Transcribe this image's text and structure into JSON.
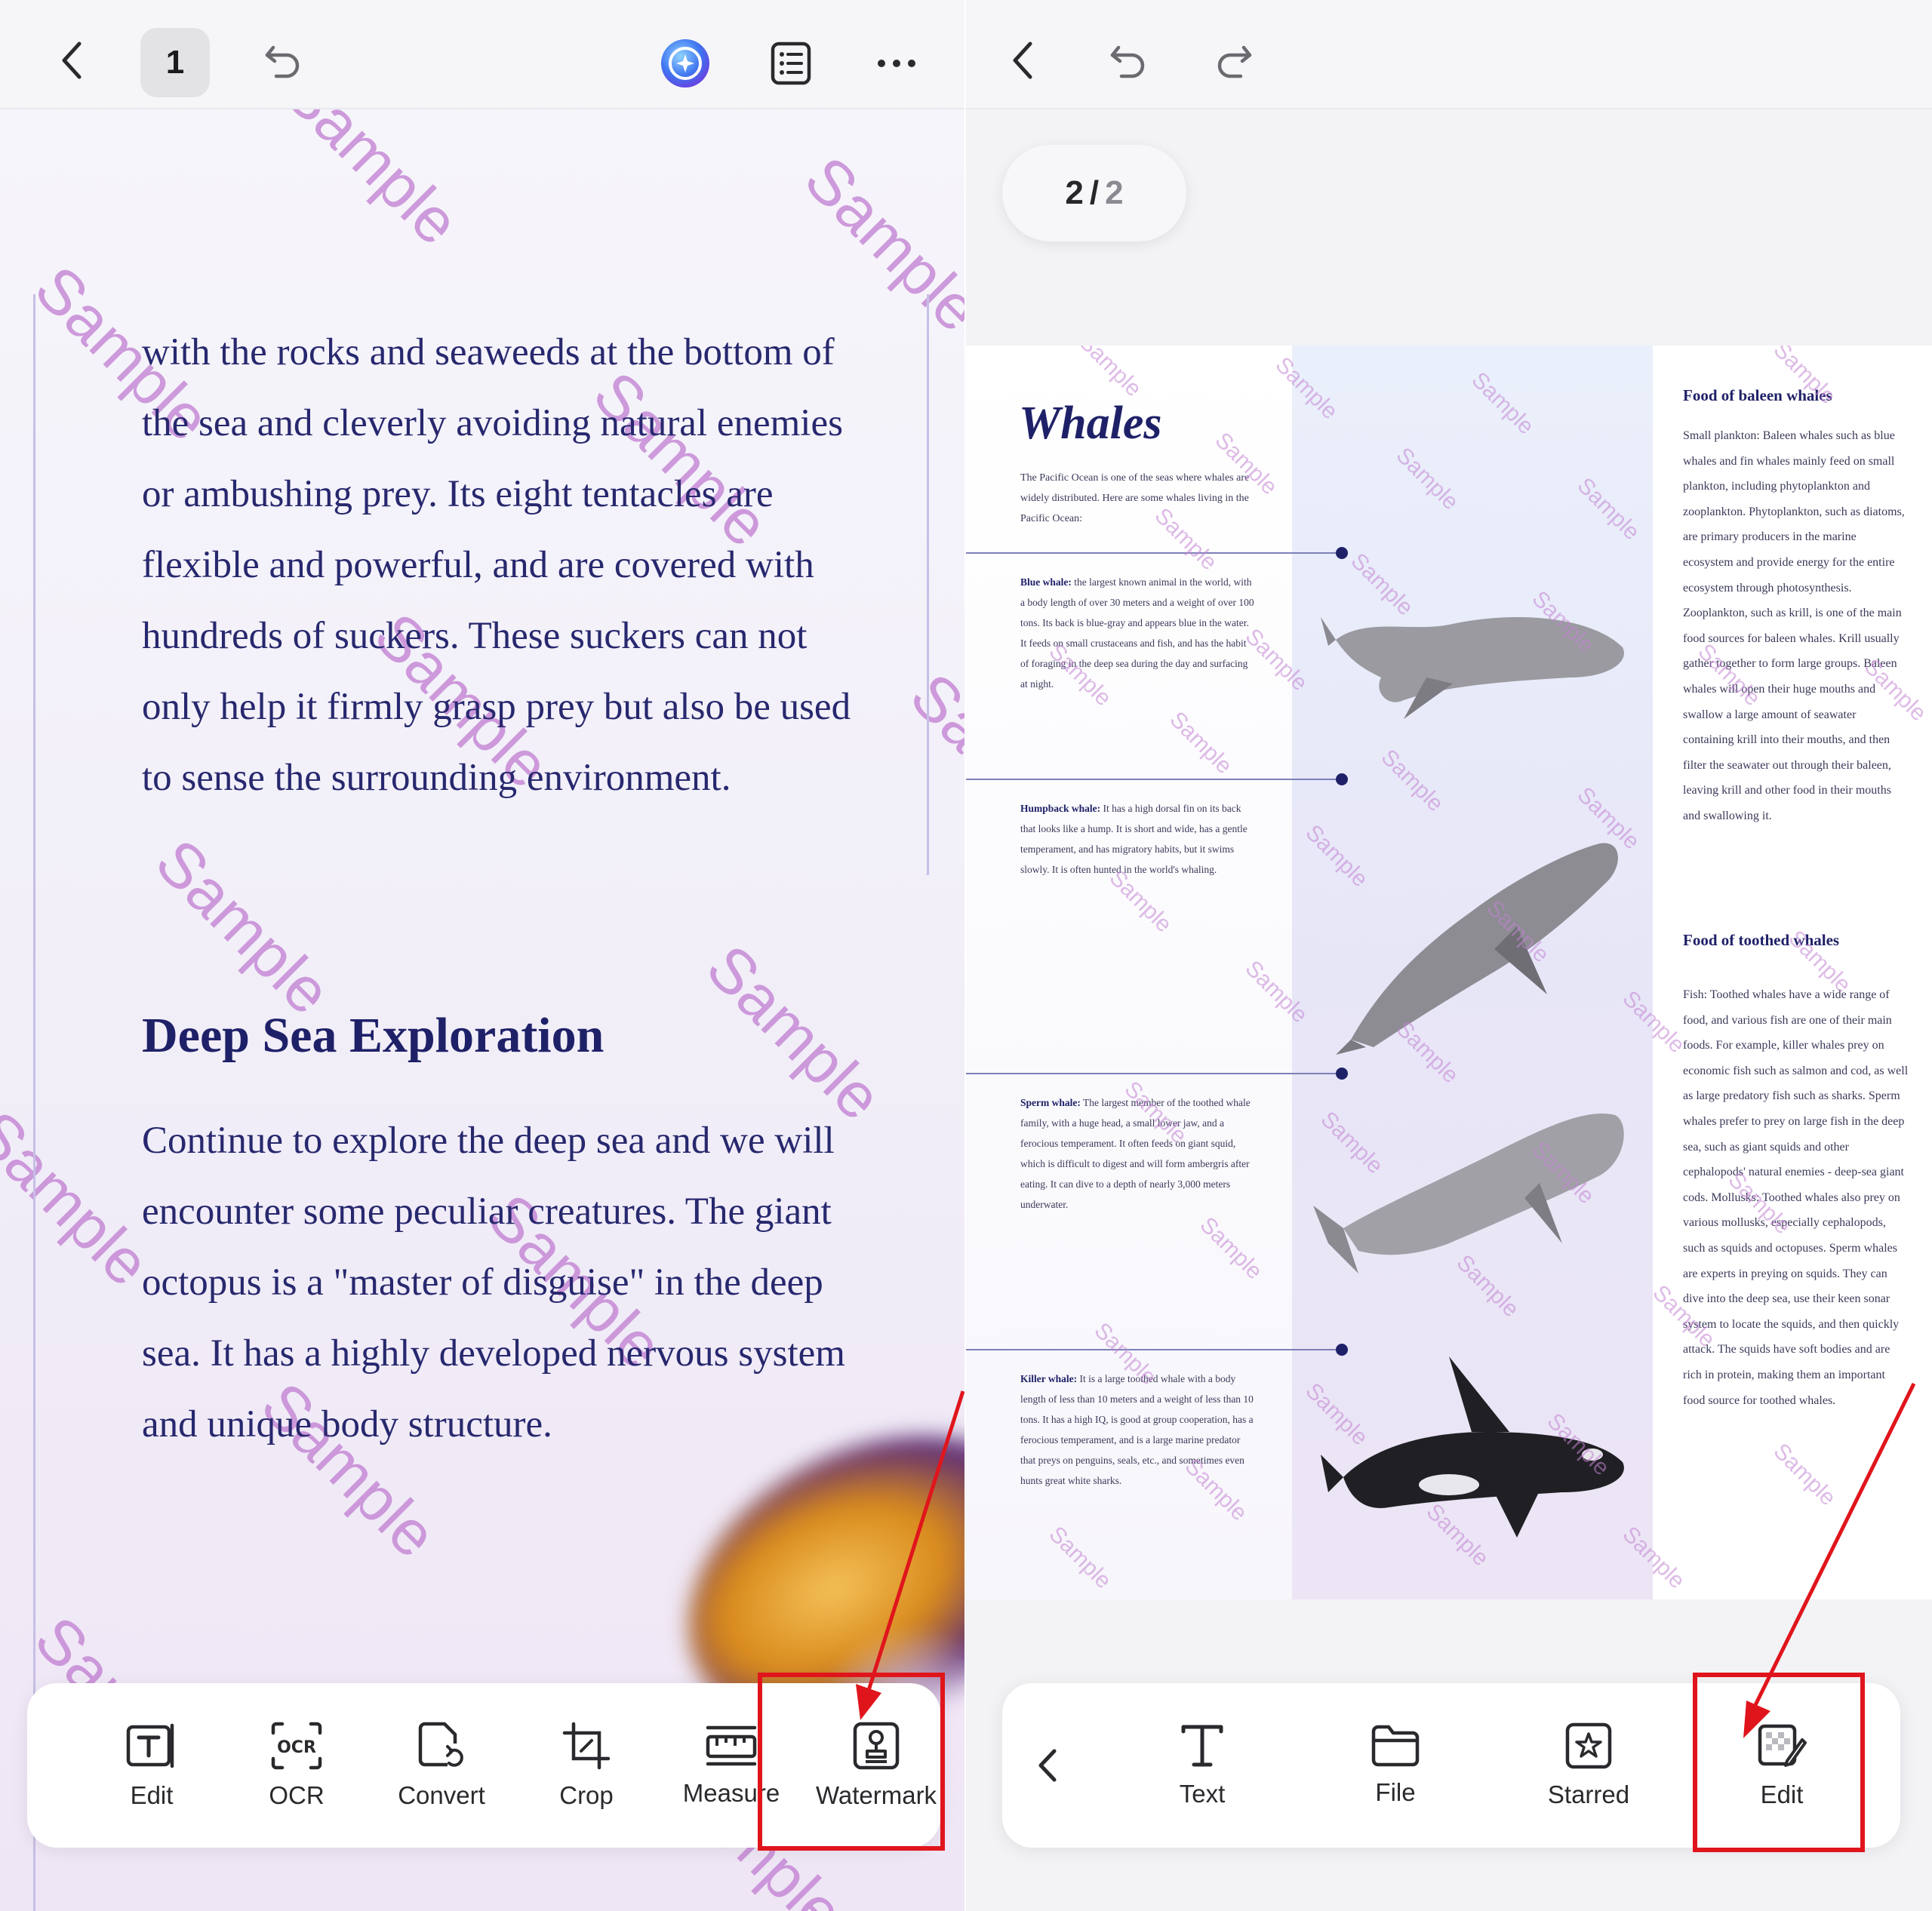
{
  "left": {
    "page_number": "1",
    "paragraph1": "with the rocks and seaweeds at the bottom of the sea and cleverly avoiding natural enemies or ambushing prey. Its eight tentacles are flexible and powerful, and are covered with hundreds of suckers. These suckers can not only help it firmly grasp prey but also be used to sense the surrounding environment.",
    "heading": "Deep Sea Exploration",
    "paragraph2": "Continue to explore the deep sea and we will encounter some peculiar creatures. The giant octopus is a \"master of disguise\" in the deep sea. It has a highly developed nervous system and unique body structure.",
    "watermark_text": "Sample",
    "toolbar": [
      {
        "label": "Edit",
        "icon": "edit-text-icon"
      },
      {
        "label": "OCR",
        "icon": "ocr-icon"
      },
      {
        "label": "Convert",
        "icon": "convert-icon"
      },
      {
        "label": "Crop",
        "icon": "crop-icon"
      },
      {
        "label": "Measure",
        "icon": "measure-icon"
      },
      {
        "label": "Watermark",
        "icon": "watermark-icon"
      }
    ]
  },
  "right": {
    "page_current": "2",
    "page_sep": "/",
    "page_total": "2",
    "doc": {
      "title": "Whales",
      "intro": "The Pacific Ocean is one of the seas where whales are widely distributed. Here are some whales living in the Pacific Ocean:",
      "whales": [
        {
          "name": "Blue whale:",
          "text": "the largest known animal in the world, with a body length of over 30 meters and a weight of over 100 tons. Its back is blue-gray and appears blue in the water. It feeds on small crustaceans and fish, and has the habit of foraging in the deep sea during the day and surfacing at night."
        },
        {
          "name": "Humpback whale:",
          "text": "It has a high dorsal fin on its back that looks like a hump. It is short and wide, has a gentle temperament, and has migratory habits, but it swims slowly. It is often hunted in the world's whaling."
        },
        {
          "name": "Sperm whale:",
          "text": "The largest member of the toothed whale family, with a huge head, a small lower jaw, and a ferocious temperament. It often feeds on giant squid, which is difficult to digest and will form ambergris after eating. It can dive to a depth of nearly 3,000 meters underwater."
        },
        {
          "name": "Killer whale:",
          "text": "It is a large toothed whale with a body length of less than 10 meters and a weight of less than 10 tons. It has a high IQ, is good at group cooperation, has a ferocious temperament, and is a large marine predator that preys on penguins, seals, etc., and sometimes even hunts great white sharks."
        }
      ],
      "food_baleen_title": "Food of baleen whales",
      "food_baleen_text": "Small plankton: Baleen whales such as blue whales and fin whales mainly feed on small plankton, including phytoplankton and zooplankton. Phytoplankton, such as diatoms, are primary producers in the marine ecosystem and provide energy for the entire ecosystem through photosynthesis. Zooplankton, such as krill, is one of the main food sources for baleen whales. Krill usually gather together to form large groups. Baleen whales will open their huge mouths and swallow a large amount of seawater containing krill into their mouths, and then filter the seawater out through their baleen, leaving krill and other food in their mouths and swallowing it.",
      "food_toothed_title": "Food of toothed whales",
      "food_toothed_text": "Fish: Toothed whales have a wide range of food, and various fish are one of their main foods. For example, killer whales prey on economic fish such as salmon and cod, as well as large predatory fish such as sharks. Sperm whales prefer to prey on large fish in the deep sea, such as giant squids and other cephalopods' natural enemies - deep-sea giant cods. Mollusks: Toothed whales also prey on various mollusks, especially cephalopods, such as squids and octopuses. Sperm whales are experts in preying on squids. They can dive into the deep sea, use their keen sonar system to locate the squids, and then quickly attack. The squids have soft bodies and are rich in protein, making them an important food source for toothed whales."
    },
    "toolbar": [
      {
        "label": "Text",
        "icon": "text-icon"
      },
      {
        "label": "File",
        "icon": "folder-icon"
      },
      {
        "label": "Starred",
        "icon": "star-icon"
      },
      {
        "label": "Edit",
        "icon": "edit-watermark-icon"
      }
    ]
  },
  "colors": {
    "navy_text": "#27286e",
    "watermark": "#c484d4",
    "highlight_red": "#e0151c",
    "ai_blue": "#3f74f0"
  }
}
